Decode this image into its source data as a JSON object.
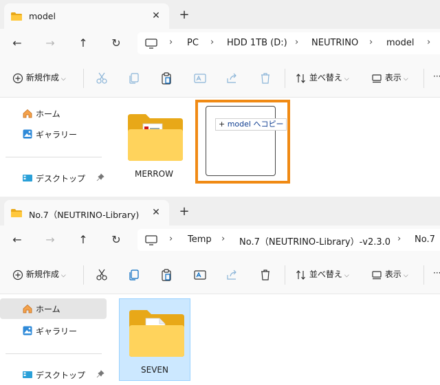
{
  "colors": {
    "accent": "#f08a14",
    "folder": "#ffc83d",
    "selection": "#cce8ff"
  },
  "window_top": {
    "tab_title": "model",
    "tab_icon": "folder-icon",
    "breadcrumb": [
      "PC",
      "HDD 1TB (D:)",
      "NEUTRINO",
      "model"
    ],
    "toolbar": {
      "new_label": "新規作成",
      "sort_label": "並べ替え",
      "view_label": "表示",
      "more_label": "···"
    },
    "nav": {
      "home": "ホーム",
      "gallery": "ギャラリー",
      "desktop": "デスクトップ"
    },
    "folders": [
      {
        "name": "MERROW",
        "has_document": true
      }
    ],
    "drag_tooltip": {
      "prefix": "+",
      "target": "model",
      "action": "へコピー"
    }
  },
  "window_bottom": {
    "tab_title": "No.7（NEUTRINO-Library)",
    "tab_icon": "folder-icon",
    "breadcrumb": [
      "Temp",
      "No.7（NEUTRINO-Library）-v2.3.0",
      "No.7"
    ],
    "toolbar": {
      "new_label": "新規作成",
      "sort_label": "並べ替え",
      "view_label": "表示",
      "more_label": "···"
    },
    "nav": {
      "home": "ホーム",
      "gallery": "ギャラリー",
      "desktop": "デスクトップ"
    },
    "folders": [
      {
        "name": "SEVEN",
        "selected": true
      }
    ]
  }
}
